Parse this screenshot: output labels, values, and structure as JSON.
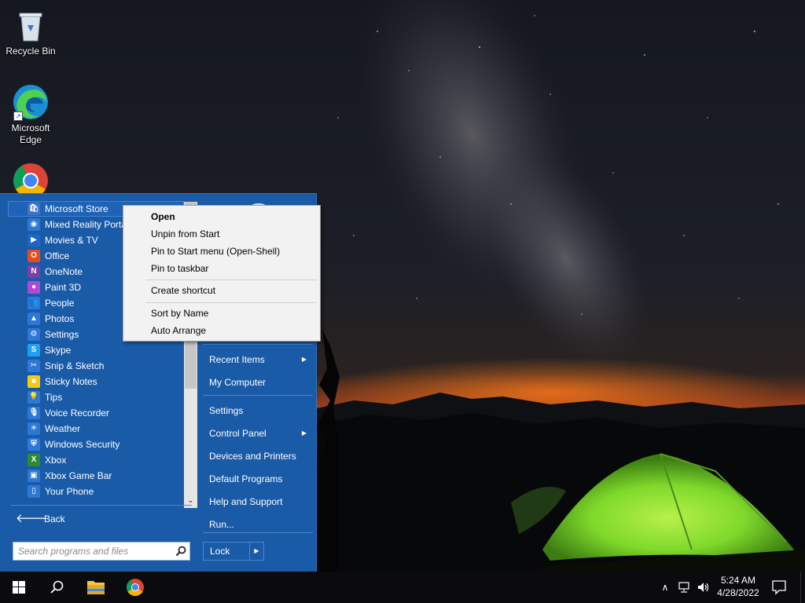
{
  "desktop": {
    "icons": [
      {
        "label": "Recycle Bin"
      },
      {
        "label": "Microsoft Edge"
      },
      {
        "label": ""
      }
    ]
  },
  "start_menu": {
    "programs": [
      {
        "label": "Microsoft Store",
        "icon": "store-icon",
        "color": "#3d72c6"
      },
      {
        "label": "Mixed Reality Portal",
        "icon": "mixed-reality-icon",
        "color": "#2c78d4"
      },
      {
        "label": "Movies & TV",
        "icon": "movies-tv-icon",
        "color": "#1e66c5"
      },
      {
        "label": "Office",
        "icon": "office-icon",
        "color": "#e8491d"
      },
      {
        "label": "OneNote",
        "icon": "onenote-icon",
        "color": "#7b3fa6"
      },
      {
        "label": "Paint 3D",
        "icon": "paint-3d-icon",
        "color": "#b14ad3"
      },
      {
        "label": "People",
        "icon": "people-icon",
        "color": "#2c78d4"
      },
      {
        "label": "Photos",
        "icon": "photos-icon",
        "color": "#2c78d4"
      },
      {
        "label": "Settings",
        "icon": "settings-gear-icon",
        "color": "#2c78d4"
      },
      {
        "label": "Skype",
        "icon": "skype-icon",
        "color": "#1da1f2"
      },
      {
        "label": "Snip & Sketch",
        "icon": "snip-sketch-icon",
        "color": "#2c78d4"
      },
      {
        "label": "Sticky Notes",
        "icon": "sticky-notes-icon",
        "color": "#f3c818"
      },
      {
        "label": "Tips",
        "icon": "tips-lightbulb-icon",
        "color": "#2c78d4"
      },
      {
        "label": "Voice Recorder",
        "icon": "voice-recorder-icon",
        "color": "#2c78d4"
      },
      {
        "label": "Weather",
        "icon": "weather-icon",
        "color": "#2c78d4"
      },
      {
        "label": "Windows Security",
        "icon": "shield-icon",
        "color": "#2c78d4"
      },
      {
        "label": "Xbox",
        "icon": "xbox-icon",
        "color": "#2e8b2e"
      },
      {
        "label": "Xbox Game Bar",
        "icon": "xbox-game-bar-icon",
        "color": "#2c78d4"
      },
      {
        "label": "Your Phone",
        "icon": "phone-icon",
        "color": "#2c78d4"
      }
    ],
    "back_label": "Back",
    "search_placeholder": "Search programs and files",
    "right_items": [
      {
        "label": "Recent Items",
        "submenu": true
      },
      {
        "label": "My Computer",
        "submenu": false
      },
      {
        "label": "Settings",
        "submenu": false
      },
      {
        "label": "Control Panel",
        "submenu": true
      },
      {
        "label": "Devices and Printers",
        "submenu": false
      },
      {
        "label": "Default Programs",
        "submenu": false
      },
      {
        "label": "Help and Support",
        "submenu": false
      },
      {
        "label": "Run...",
        "submenu": false
      }
    ],
    "lock_label": "Lock",
    "arrow_glyph": "▶",
    "back_glyph": "🡐",
    "scroll_down_glyph": "⌄"
  },
  "context_menu": {
    "items": [
      {
        "label": "Open",
        "bold": true
      },
      {
        "label": "Unpin from Start",
        "bold": false
      },
      {
        "label": "Pin to Start menu (Open-Shell)",
        "bold": false
      },
      {
        "label": "Pin to taskbar",
        "bold": false
      },
      {
        "label": "Create shortcut",
        "bold": false
      },
      {
        "label": "Sort by Name",
        "bold": false
      },
      {
        "label": "Auto Arrange",
        "bold": false
      }
    ]
  },
  "taskbar": {
    "tray_chevron": "∧",
    "time": "5:24 AM",
    "date": "4/28/2022"
  },
  "colors": {
    "menu_blue": "#1a5ba8",
    "accent_blue": "#1e63b6",
    "tent_green": "#7fd92b"
  }
}
